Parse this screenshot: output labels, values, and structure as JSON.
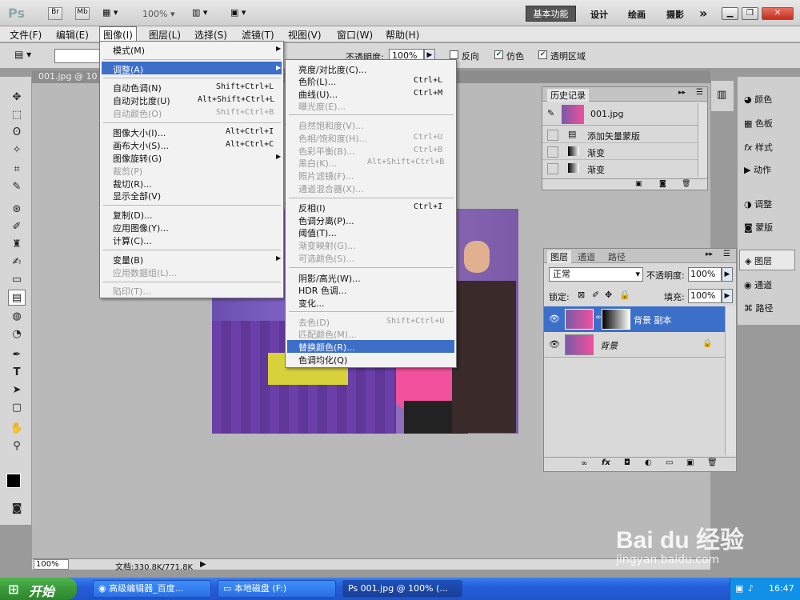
{
  "appbar": {
    "logo": "Ps",
    "br": "Br",
    "mb": "Mb",
    "zoom": "100%",
    "workspace": [
      "基本功能",
      "设计",
      "绘画",
      "摄影"
    ],
    "more": "»"
  },
  "menubar": {
    "items": [
      "文件(F)",
      "编辑(E)",
      "图像(I)",
      "图层(L)",
      "选择(S)",
      "滤镜(T)",
      "视图(V)",
      "窗口(W)",
      "帮助(H)"
    ]
  },
  "options": {
    "opacity_label": "不透明度:",
    "opacity_value": "100%",
    "reverse": "反向",
    "dither": "仿色",
    "transparency": "透明区域"
  },
  "doc": {
    "tab": "001.jpg @ 10"
  },
  "status": {
    "zoom": "100%",
    "docsize": "文档:330.8K/771.8K"
  },
  "image_menu": {
    "items": [
      {
        "label": "模式(M)",
        "shortcut": "",
        "submenu": true,
        "disabled": false
      },
      {
        "label": "调整(A)",
        "shortcut": "",
        "submenu": true,
        "disabled": false,
        "highlight": true
      },
      {
        "label": "自动色调(N)",
        "shortcut": "Shift+Ctrl+L",
        "disabled": false
      },
      {
        "label": "自动对比度(U)",
        "shortcut": "Alt+Shift+Ctrl+L",
        "disabled": false
      },
      {
        "label": "自动颜色(O)",
        "shortcut": "Shift+Ctrl+B",
        "disabled": true
      },
      {
        "label": "图像大小(I)...",
        "shortcut": "Alt+Ctrl+I",
        "disabled": false
      },
      {
        "label": "画布大小(S)...",
        "shortcut": "Alt+Ctrl+C",
        "disabled": false
      },
      {
        "label": "图像旋转(G)",
        "shortcut": "",
        "submenu": true,
        "disabled": false
      },
      {
        "label": "裁剪(P)",
        "shortcut": "",
        "disabled": true
      },
      {
        "label": "裁切(R)...",
        "shortcut": "",
        "disabled": false
      },
      {
        "label": "显示全部(V)",
        "shortcut": "",
        "disabled": false
      },
      {
        "label": "复制(D)...",
        "shortcut": "",
        "disabled": false
      },
      {
        "label": "应用图像(Y)...",
        "shortcut": "",
        "disabled": false
      },
      {
        "label": "计算(C)...",
        "shortcut": "",
        "disabled": false
      },
      {
        "label": "变量(B)",
        "shortcut": "",
        "submenu": true,
        "disabled": false
      },
      {
        "label": "应用数据组(L)...",
        "shortcut": "",
        "disabled": true
      },
      {
        "label": "陷印(T)...",
        "shortcut": "",
        "disabled": true
      }
    ]
  },
  "adjust_menu": {
    "items": [
      {
        "label": "亮度/对比度(C)...",
        "shortcut": "",
        "disabled": false
      },
      {
        "label": "色阶(L)...",
        "shortcut": "Ctrl+L",
        "disabled": false
      },
      {
        "label": "曲线(U)...",
        "shortcut": "Ctrl+M",
        "disabled": false
      },
      {
        "label": "曝光度(E)...",
        "shortcut": "",
        "disabled": true
      },
      {
        "label": "自然饱和度(V)...",
        "shortcut": "",
        "disabled": true
      },
      {
        "label": "色相/饱和度(H)...",
        "shortcut": "Ctrl+U",
        "disabled": true
      },
      {
        "label": "色彩平衡(B)...",
        "shortcut": "Ctrl+B",
        "disabled": true
      },
      {
        "label": "黑白(K)...",
        "shortcut": "Alt+Shift+Ctrl+B",
        "disabled": true
      },
      {
        "label": "照片滤镜(F)...",
        "shortcut": "",
        "disabled": true
      },
      {
        "label": "通道混合器(X)...",
        "shortcut": "",
        "disabled": true
      },
      {
        "label": "反相(I)",
        "shortcut": "Ctrl+I",
        "disabled": false
      },
      {
        "label": "色调分离(P)...",
        "shortcut": "",
        "disabled": false
      },
      {
        "label": "阈值(T)...",
        "shortcut": "",
        "disabled": false
      },
      {
        "label": "渐变映射(G)...",
        "shortcut": "",
        "disabled": true
      },
      {
        "label": "可选颜色(S)...",
        "shortcut": "",
        "disabled": true
      },
      {
        "label": "阴影/高光(W)...",
        "shortcut": "",
        "disabled": false
      },
      {
        "label": "HDR 色调...",
        "shortcut": "",
        "disabled": false
      },
      {
        "label": "变化...",
        "shortcut": "",
        "disabled": false
      },
      {
        "label": "去色(D)",
        "shortcut": "Shift+Ctrl+U",
        "disabled": true
      },
      {
        "label": "匹配颜色(M)...",
        "shortcut": "",
        "disabled": true
      },
      {
        "label": "替换颜色(R)...",
        "shortcut": "",
        "disabled": false,
        "highlight": true
      },
      {
        "label": "色调均化(Q)",
        "shortcut": "",
        "disabled": false
      }
    ]
  },
  "history": {
    "title": "历史记录",
    "snapshot": "001.jpg",
    "items": [
      "添加矢量蒙版",
      "渐变",
      "渐变"
    ]
  },
  "layers": {
    "tabs": [
      "图层",
      "通道",
      "路径"
    ],
    "blend": "正常",
    "opacity_label": "不透明度:",
    "opacity_value": "100%",
    "lock_label": "锁定:",
    "fill_label": "填充:",
    "fill_value": "100%",
    "items": [
      {
        "name": "背景 副本",
        "selected": true
      },
      {
        "name": "背景",
        "selected": false
      }
    ]
  },
  "dock": {
    "items": [
      "颜色",
      "色板",
      "样式",
      "动作",
      "调整",
      "蒙版",
      "图层",
      "通道",
      "路径"
    ]
  },
  "taskbar": {
    "start": "开始",
    "tasks": [
      "高级编辑器_百度...",
      "本地磁盘 (F:)",
      "001.jpg @ 100% (..."
    ],
    "time": "16:47"
  },
  "watermark": {
    "line1": "Bai du 经验",
    "line2": "jingyan.baidu.com"
  },
  "colors": {
    "menu_highlight": "#3c6fc8",
    "layer_selected": "#3c6fc8",
    "taskbar": "#245edb",
    "start": "#3a9a3a"
  }
}
